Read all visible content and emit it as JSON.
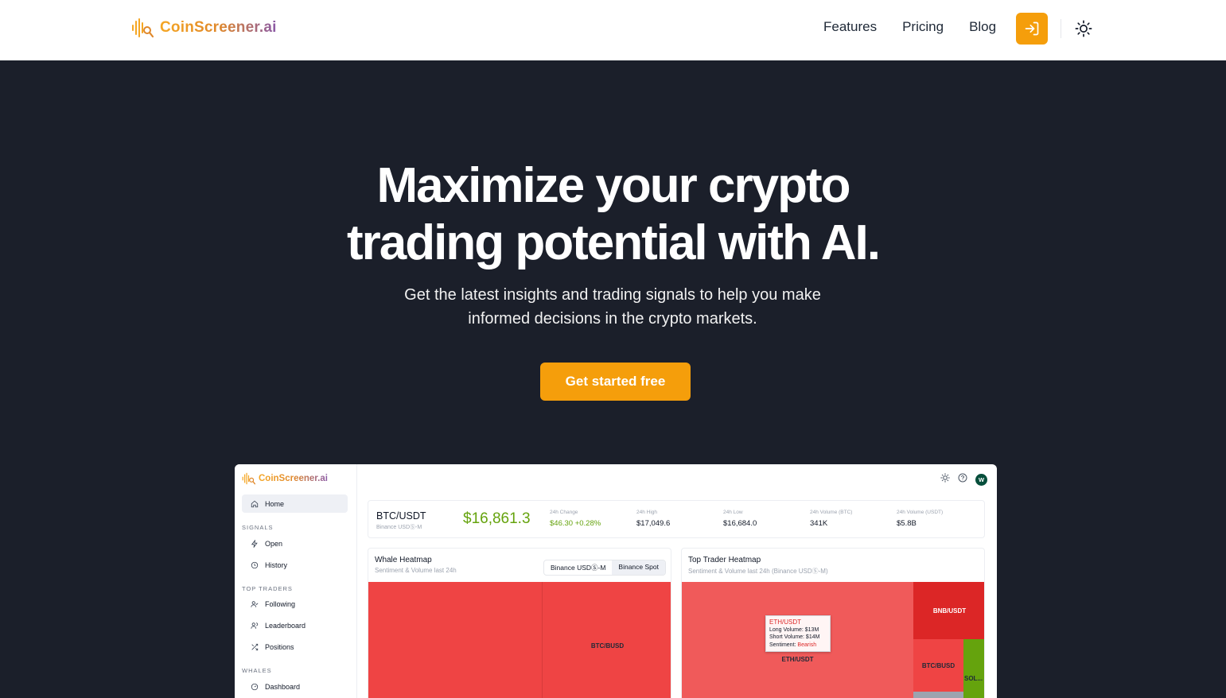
{
  "brand": {
    "name": "CoinScreener.ai",
    "accent": "#f59e0b"
  },
  "nav": {
    "links": [
      "Features",
      "Pricing",
      "Blog"
    ]
  },
  "hero": {
    "title_line1": "Maximize your crypto",
    "title_line2": "trading potential with AI.",
    "subtitle": "Get the latest insights and trading signals to help you make informed decisions in the crypto markets.",
    "cta": "Get started free"
  },
  "preview": {
    "brand": "CoinScreener.ai",
    "avatar": "W",
    "sidebar": {
      "home": "Home",
      "signals_section": "SIGNALS",
      "signals": [
        "Open",
        "History"
      ],
      "traders_section": "TOP TRADERS",
      "traders": [
        "Following",
        "Leaderboard",
        "Positions"
      ],
      "whales_section": "WHALES",
      "whales": [
        "Dashboard"
      ]
    },
    "ticker": {
      "pair": "BTC/USDT",
      "exchange": "Binance USDⓈ-M",
      "price": "$16,861.3",
      "stats": [
        {
          "label": "24h Change",
          "value": "$46.30 +0.28%"
        },
        {
          "label": "24h High",
          "value": "$17,049.6"
        },
        {
          "label": "24h Low",
          "value": "$16,684.0"
        },
        {
          "label": "24h Volume (BTC)",
          "value": "341K"
        },
        {
          "label": "24h Volume (USDT)",
          "value": "$5.8B"
        }
      ]
    },
    "whale": {
      "title": "Whale Heatmap",
      "subtitle": "Sentiment & Volume last 24h",
      "tabs": [
        "Binance USDⓈ-M",
        "Binance Spot"
      ],
      "selected_tab": "Binance Spot",
      "tiles": [
        "BTC/BUSD"
      ]
    },
    "trader": {
      "title": "Top Trader Heatmap",
      "subtitle": "Sentiment & Volume last 24h (Binance USDⓈ-M)",
      "tiles": [
        "ETH/USDT",
        "BNB/USDT",
        "BTC/BUSD",
        "SOL..."
      ],
      "tooltip": {
        "title": "ETH/USDT",
        "long_label": "Long Volume:",
        "long_value": "$13M",
        "short_label": "Short Volume:",
        "short_value": "$14M",
        "sentiment_label": "Sentiment:",
        "sentiment_value": "Bearish"
      }
    }
  }
}
